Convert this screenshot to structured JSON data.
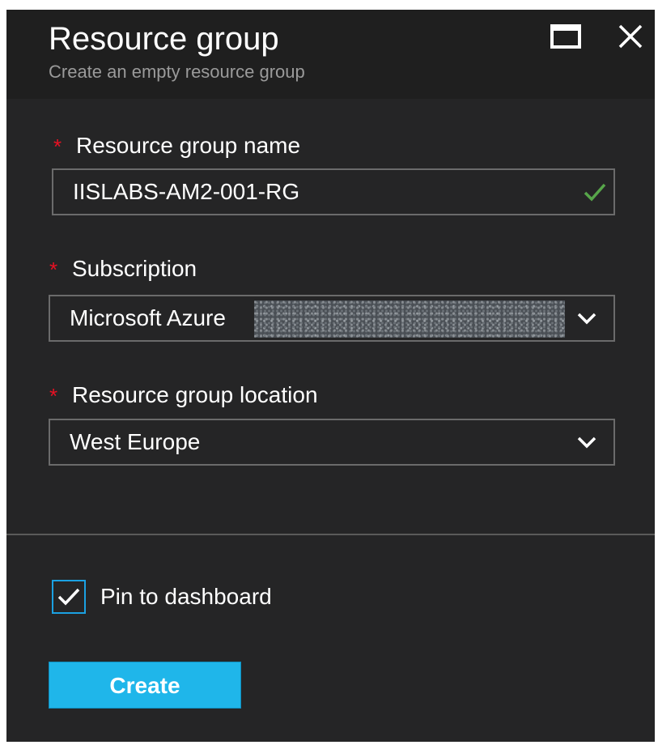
{
  "header": {
    "title": "Resource group",
    "subtitle": "Create an empty resource group"
  },
  "form": {
    "name": {
      "label": "Resource group name",
      "required_mark": "*",
      "value": "IISLABS-AM2-001-RG"
    },
    "subscription": {
      "label": "Subscription",
      "required_mark": "*",
      "value": "Microsoft Azure"
    },
    "location": {
      "label": "Resource group location",
      "required_mark": "*",
      "value": "West Europe"
    }
  },
  "pin": {
    "label": "Pin to dashboard",
    "checked": true
  },
  "actions": {
    "create_label": "Create"
  },
  "icons": {
    "maximize": "maximize-icon",
    "close": "close-icon",
    "valid": "checkmark-icon",
    "dropdown": "chevron-down-icon",
    "checkbox": "checkbox-checked-icon"
  },
  "colors": {
    "background": "#252526",
    "accent": "#1fb6ea",
    "required": "#e81123",
    "valid": "#57a64a",
    "checkbox_border": "#1ba1e2"
  }
}
